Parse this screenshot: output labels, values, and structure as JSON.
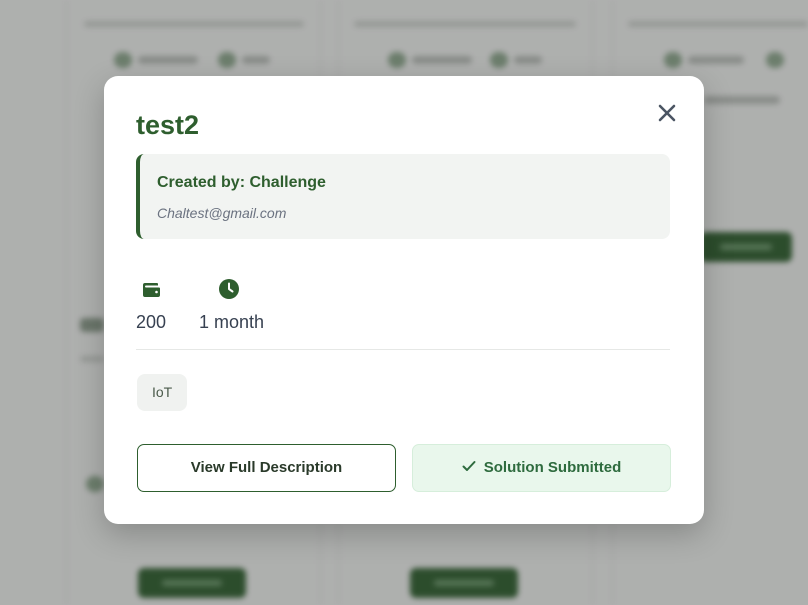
{
  "modal": {
    "title": "test2",
    "creator": {
      "name_line": "Created by: Challenge",
      "email": "Chaltest@gmail.com"
    },
    "stats": {
      "budget_icon": "wallet-icon",
      "budget_value": "200",
      "duration_icon": "clock-icon",
      "duration_value": "1 month"
    },
    "tags": [
      "IoT"
    ],
    "buttons": {
      "view_description_label": "View Full Description",
      "solution_submitted_label": "Solution Submitted",
      "solution_submitted_icon": "check-icon"
    },
    "close_icon": "close-icon"
  },
  "colors": {
    "brand_green": "#2e5e2e",
    "success_bg": "#e9f7ec",
    "success_text": "#2e6b3e",
    "creator_box_bg": "#f2f4f2"
  }
}
